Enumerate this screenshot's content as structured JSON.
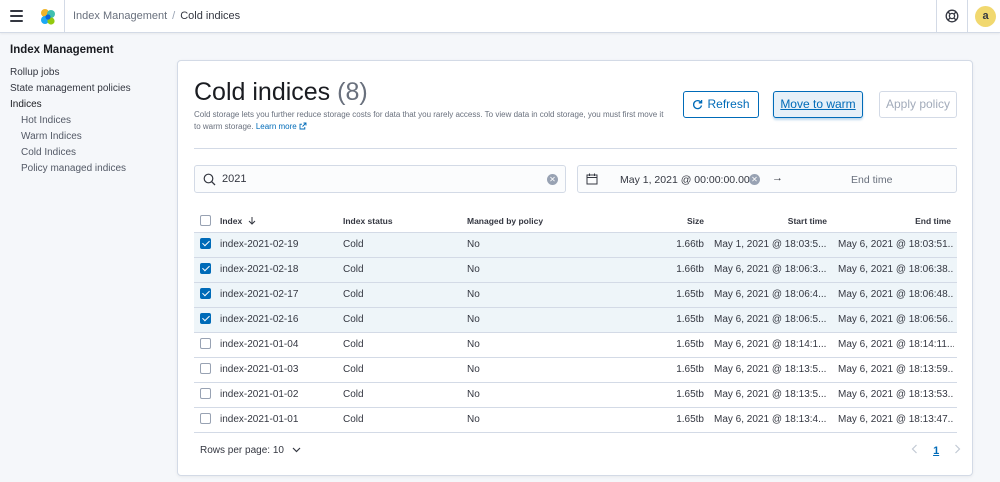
{
  "header": {
    "breadcrumbs": [
      "Index Management",
      "Cold indices"
    ],
    "breadcrumb_separator": "/",
    "user_initial": "a",
    "avatar_color": "#f1d86f"
  },
  "sidebar": {
    "title": "Index Management",
    "items": [
      {
        "label": "Rollup jobs",
        "sub": false
      },
      {
        "label": "State management policies",
        "sub": false
      },
      {
        "label": "Indices",
        "sub": false
      },
      {
        "label": "Hot Indices",
        "sub": true
      },
      {
        "label": "Warm Indices",
        "sub": true
      },
      {
        "label": "Cold Indices",
        "sub": true
      },
      {
        "label": "Policy managed indices",
        "sub": true
      }
    ]
  },
  "main": {
    "title": "Cold indices",
    "count": "(8)",
    "description": "Cold storage lets you further reduce storage costs for data that you rarely access. To view data in cold storage, you must first move it to warm storage.",
    "learn_more": "Learn more",
    "buttons": {
      "refresh": "Refresh",
      "move_to_warm": "Move to warm",
      "apply_policy": "Apply policy"
    },
    "search": {
      "value": "2021",
      "clear_icon": "clear-icon"
    },
    "date_range": {
      "start": "May 1, 2021 @ 00:00:00.000",
      "arrow": "→",
      "end_placeholder": "End time"
    },
    "table": {
      "columns": {
        "index": "Index",
        "status": "Index status",
        "managed": "Managed by policy",
        "size": "Size",
        "start": "Start time",
        "end": "End time"
      },
      "rows": [
        {
          "selected": true,
          "index": "index-2021-02-19",
          "status": "Cold",
          "managed": "No",
          "size": "1.66tb",
          "start": "May 1, 2021 @ 18:03:5...",
          "end": "May 6, 2021 @ 18:03:51..."
        },
        {
          "selected": true,
          "index": "index-2021-02-18",
          "status": "Cold",
          "managed": "No",
          "size": "1.66tb",
          "start": "May 6, 2021 @ 18:06:3...",
          "end": "May 6, 2021 @ 18:06:38..."
        },
        {
          "selected": true,
          "index": "index-2021-02-17",
          "status": "Cold",
          "managed": "No",
          "size": "1.65tb",
          "start": "May 6, 2021 @ 18:06:4...",
          "end": "May 6, 2021 @ 18:06:48..."
        },
        {
          "selected": true,
          "index": "index-2021-02-16",
          "status": "Cold",
          "managed": "No",
          "size": "1.65tb",
          "start": "May 6, 2021 @ 18:06:5...",
          "end": "May 6, 2021 @ 18:06:56..."
        },
        {
          "selected": false,
          "index": "index-2021-01-04",
          "status": "Cold",
          "managed": "No",
          "size": "1.65tb",
          "start": "May 6, 2021 @ 18:14:1...",
          "end": "May 6, 2021 @ 18:14:11..."
        },
        {
          "selected": false,
          "index": "index-2021-01-03",
          "status": "Cold",
          "managed": "No",
          "size": "1.65tb",
          "start": "May 6, 2021 @ 18:13:5...",
          "end": "May 6, 2021 @ 18:13:59..."
        },
        {
          "selected": false,
          "index": "index-2021-01-02",
          "status": "Cold",
          "managed": "No",
          "size": "1.65tb",
          "start": "May 6, 2021 @ 18:13:5...",
          "end": "May 6, 2021 @ 18:13:53..."
        },
        {
          "selected": false,
          "index": "index-2021-01-01",
          "status": "Cold",
          "managed": "No",
          "size": "1.65tb",
          "start": "May 6, 2021 @ 18:13:4...",
          "end": "May 6, 2021 @ 18:13:47..."
        }
      ]
    },
    "pagination": {
      "rows_per_page": "Rows per page: 10",
      "current_page": "1"
    }
  },
  "colors": {
    "primary": "#006bb8",
    "selected_row": "#eef5f9",
    "border": "#d3dae6"
  }
}
